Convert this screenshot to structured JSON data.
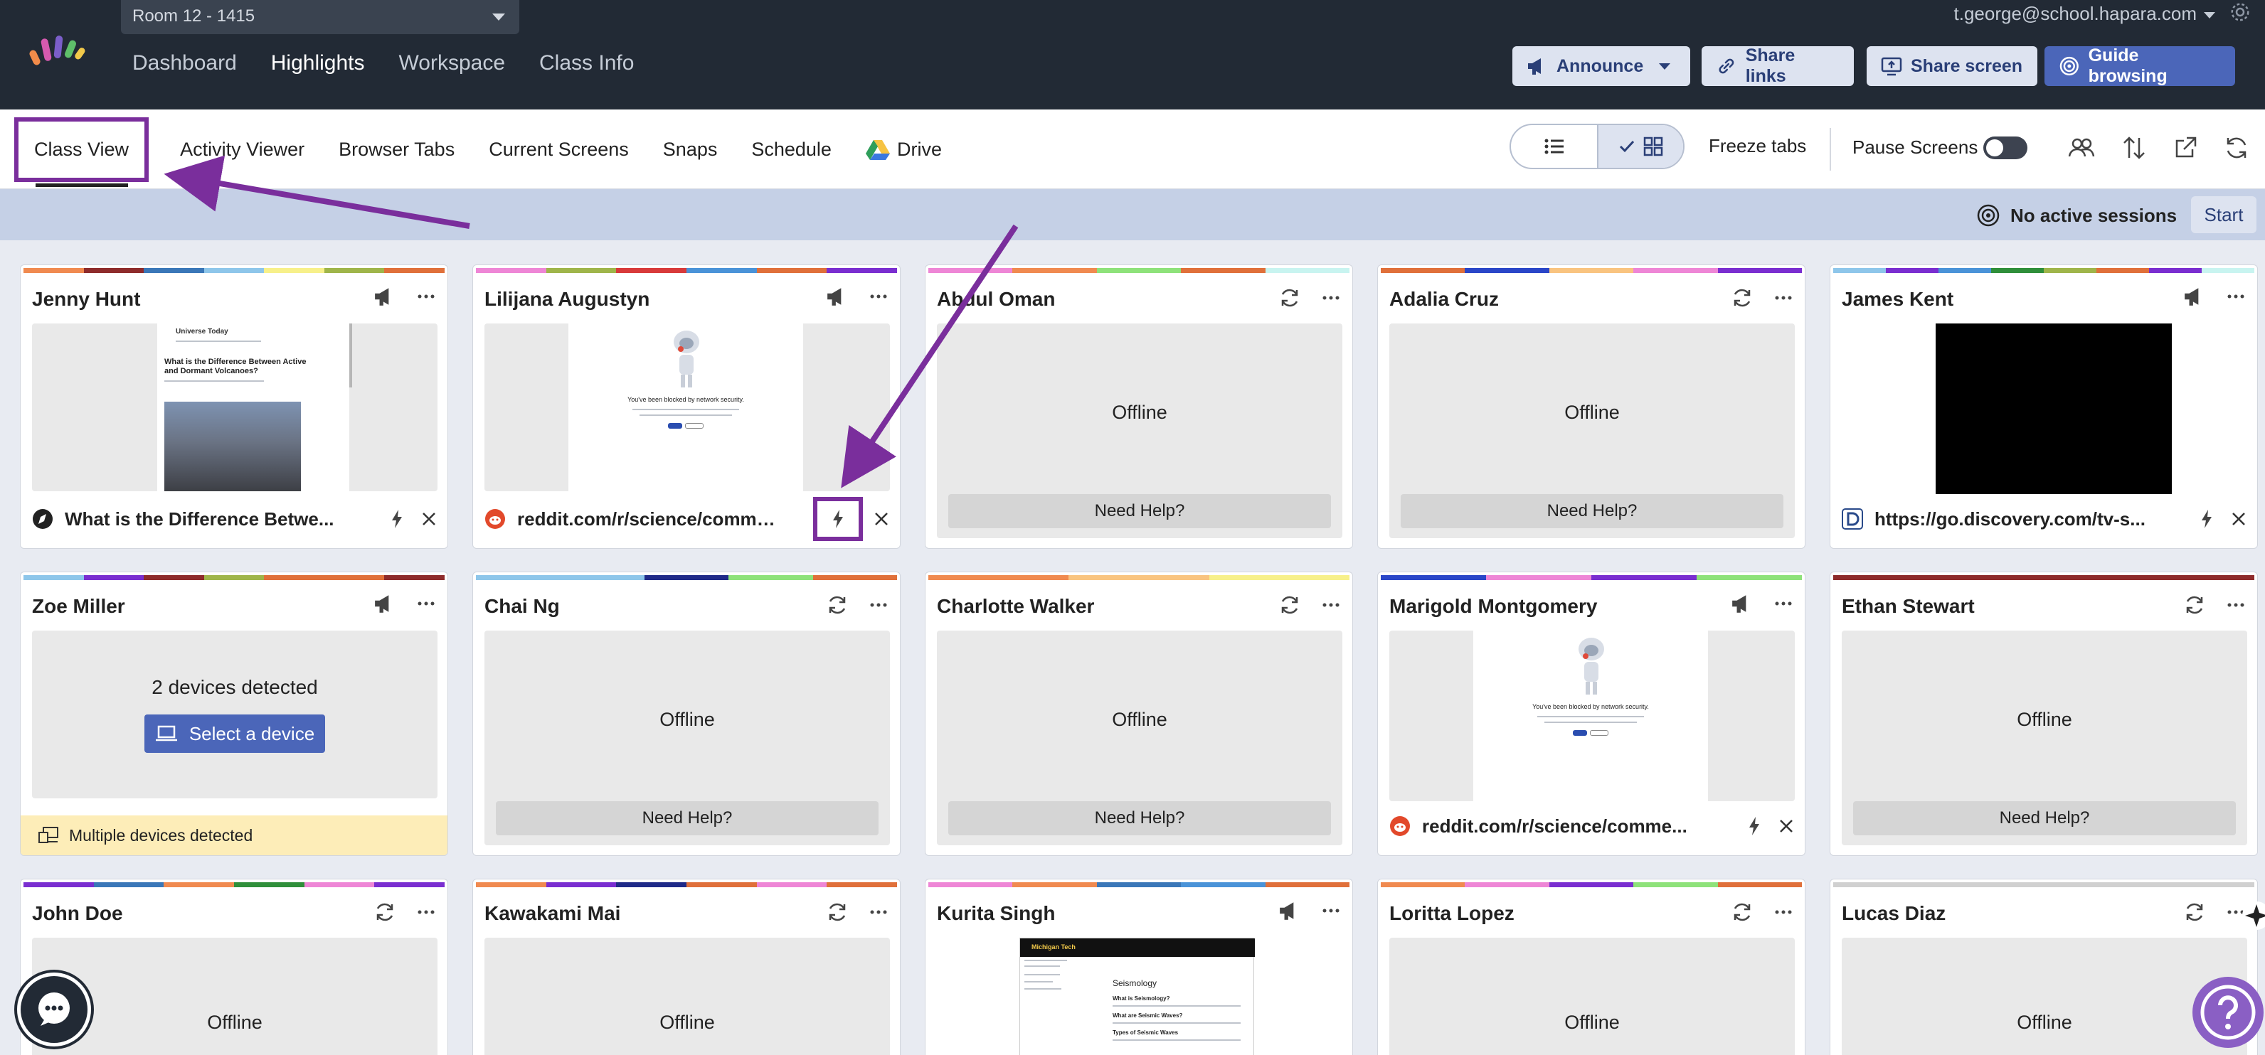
{
  "header": {
    "room": "Room 12 - 1415",
    "nav": [
      "Dashboard",
      "Highlights",
      "Workspace",
      "Class Info"
    ],
    "active_nav": "Highlights",
    "user_email": "t.george@school.hapara.com",
    "buttons": {
      "announce": "Announce",
      "share_links": "Share links",
      "share_screen": "Share screen",
      "guide_browsing": "Guide browsing"
    }
  },
  "toolbar": {
    "tabs": [
      "Class View",
      "Activity Viewer",
      "Browser Tabs",
      "Current Screens",
      "Snaps",
      "Schedule",
      "Drive"
    ],
    "active_tab": "Class View",
    "freeze_tabs": "Freeze tabs",
    "pause_screens": "Pause Screens",
    "pause_screens_on": false,
    "view_mode": "grid"
  },
  "session": {
    "status": "No active sessions",
    "start": "Start"
  },
  "students": [
    {
      "name": "Jenny Hunt",
      "state": "online",
      "url": "What is the Difference Betwe...",
      "favicon": "compass-icon",
      "preview_title": "What is the Difference Between Active and Dormant Volcanoes?",
      "preview_site": "Universe Today"
    },
    {
      "name": "Lilijana Augustyn",
      "state": "online",
      "url": "reddit.com/r/science/comme...",
      "favicon": "reddit-icon",
      "preview_text": "You've been blocked by network security."
    },
    {
      "name": "Abdul Oman",
      "state": "offline",
      "offline": "Offline",
      "help": "Need Help?"
    },
    {
      "name": "Adalia Cruz",
      "state": "offline",
      "offline": "Offline",
      "help": "Need Help?"
    },
    {
      "name": "James Kent",
      "state": "online",
      "url": "https://go.discovery.com/tv-s...",
      "favicon": "discovery-icon"
    },
    {
      "name": "Zoe Miller",
      "state": "multi",
      "devices": "2 devices detected",
      "select": "Select a device",
      "notice": "Multiple devices detected"
    },
    {
      "name": "Chai Ng",
      "state": "offline",
      "offline": "Offline",
      "help": "Need Help?"
    },
    {
      "name": "Charlotte Walker",
      "state": "offline",
      "offline": "Offline",
      "help": "Need Help?"
    },
    {
      "name": "Marigold Montgomery",
      "state": "online",
      "url": "reddit.com/r/science/comme...",
      "favicon": "reddit-icon",
      "preview_text": "You've been blocked by network security."
    },
    {
      "name": "Ethan Stewart",
      "state": "offline",
      "offline": "Offline",
      "help": "Need Help?"
    },
    {
      "name": "John Doe",
      "state": "offline",
      "offline": "Offline"
    },
    {
      "name": "Kawakami Mai",
      "state": "offline",
      "offline": "Offline"
    },
    {
      "name": "Kurita Singh",
      "state": "online",
      "preview_site": "Michigan Tech",
      "preview_title": "Seismology",
      "preview_sub": "What is Seismology?",
      "preview_sub2": "What are Seismic Waves?",
      "preview_sub3": "Types of Seismic Waves"
    },
    {
      "name": "Loritta Lopez",
      "state": "offline",
      "offline": "Offline"
    },
    {
      "name": "Lucas Diaz",
      "state": "offline",
      "offline": "Offline"
    }
  ],
  "colors": {
    "topbar": "#222a35",
    "accent": "#4b66b9",
    "highlight": "#7a2e9c",
    "session_bar": "#c5d0e6"
  }
}
